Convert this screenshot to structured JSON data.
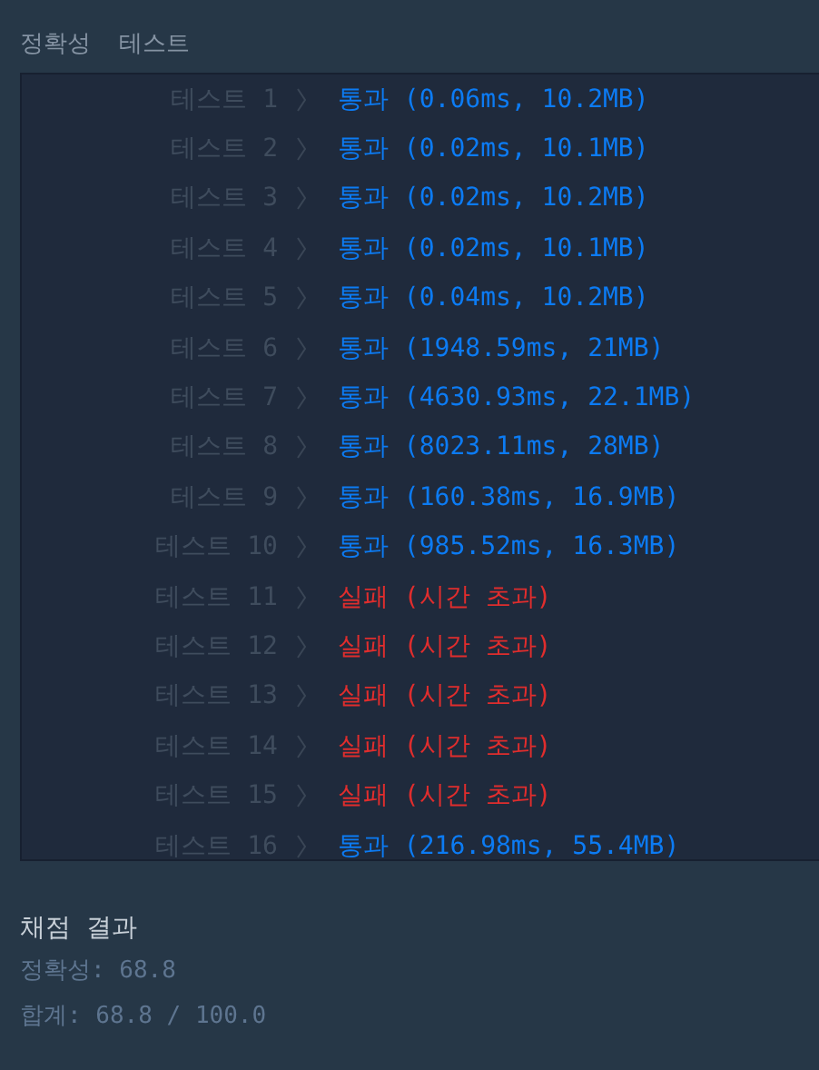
{
  "section_title": "정확성  테스트",
  "tests": [
    {
      "label": "테스트 1",
      "kind": "pass",
      "result": "통과 (0.06ms, 10.2MB)"
    },
    {
      "label": "테스트 2",
      "kind": "pass",
      "result": "통과 (0.02ms, 10.1MB)"
    },
    {
      "label": "테스트 3",
      "kind": "pass",
      "result": "통과 (0.02ms, 10.2MB)"
    },
    {
      "label": "테스트 4",
      "kind": "pass",
      "result": "통과 (0.02ms, 10.1MB)"
    },
    {
      "label": "테스트 5",
      "kind": "pass",
      "result": "통과 (0.04ms, 10.2MB)"
    },
    {
      "label": "테스트 6",
      "kind": "pass",
      "result": "통과 (1948.59ms, 21MB)"
    },
    {
      "label": "테스트 7",
      "kind": "pass",
      "result": "통과 (4630.93ms, 22.1MB)"
    },
    {
      "label": "테스트 8",
      "kind": "pass",
      "result": "통과 (8023.11ms, 28MB)"
    },
    {
      "label": "테스트 9",
      "kind": "pass",
      "result": "통과 (160.38ms, 16.9MB)"
    },
    {
      "label": "테스트 10",
      "kind": "pass",
      "result": "통과 (985.52ms, 16.3MB)"
    },
    {
      "label": "테스트 11",
      "kind": "fail",
      "result": "실패 (시간 초과)"
    },
    {
      "label": "테스트 12",
      "kind": "fail",
      "result": "실패 (시간 초과)"
    },
    {
      "label": "테스트 13",
      "kind": "fail",
      "result": "실패 (시간 초과)"
    },
    {
      "label": "테스트 14",
      "kind": "fail",
      "result": "실패 (시간 초과)"
    },
    {
      "label": "테스트 15",
      "kind": "fail",
      "result": "실패 (시간 초과)"
    },
    {
      "label": "테스트 16",
      "kind": "pass",
      "result": "통과 (216.98ms, 55.4MB)"
    }
  ],
  "summary": {
    "title": "채점 결과",
    "lines": [
      "정확성: 68.8",
      "합계: 68.8 / 100.0"
    ]
  }
}
